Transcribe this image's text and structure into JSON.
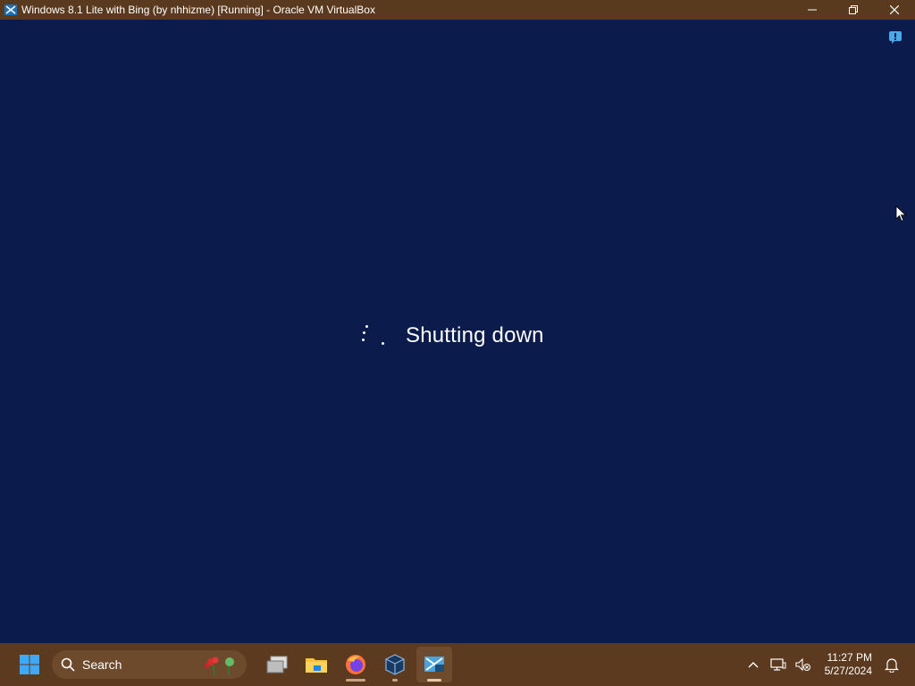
{
  "window": {
    "title": "Windows 8.1 Lite with Bing (by nhhizme) [Running] - Oracle VM VirtualBox",
    "app_icon": "virtualbox-icon",
    "controls": [
      "minimize-icon",
      "restore-icon",
      "close-icon"
    ]
  },
  "vm": {
    "status_text": "Shutting down",
    "background_color": "#0b1b4b",
    "notification_icon": "vm-notification-icon"
  },
  "taskbar": {
    "start_icon": "windows-start-icon",
    "search_placeholder": "Search",
    "apps": [
      {
        "name": "task-view",
        "icon": "task-view-icon"
      },
      {
        "name": "file-explorer",
        "icon": "folder-icon"
      },
      {
        "name": "firefox",
        "icon": "firefox-icon"
      },
      {
        "name": "virtualbox-manager",
        "icon": "virtualbox-icon"
      },
      {
        "name": "virtualbox-vm",
        "icon": "vm-window-icon",
        "active": true
      }
    ],
    "tray": {
      "chevron": "chevron-up-icon",
      "network": "network-icon",
      "volume": "volume-muted-icon",
      "time": "11:27 PM",
      "date": "5/27/2024",
      "notifications": "bell-icon"
    },
    "colors": {
      "taskbar": "#5c3a1f",
      "titlebar": "#5a3a1e"
    }
  }
}
